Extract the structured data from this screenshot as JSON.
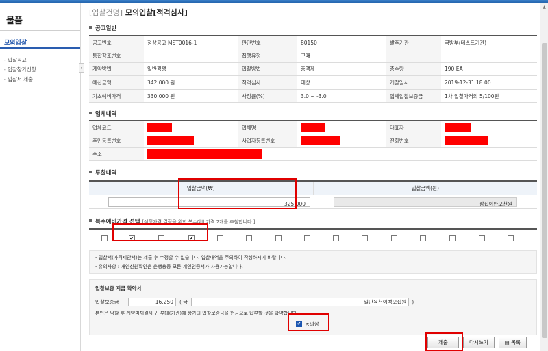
{
  "sidebar": {
    "title": "물품",
    "menu": "모의입찰",
    "items": [
      "- 입찰공고",
      "- 입찰참가신청",
      "- 입찰서 제출"
    ]
  },
  "page": {
    "category": "[입찰건명]",
    "title": "모의입찰[적격심사]"
  },
  "sections": {
    "notice": "공고일반",
    "company": "업체내역",
    "bid": "투찰내역"
  },
  "notice_rows": [
    [
      [
        "공고번호",
        "정상공고 MST0016-1"
      ],
      [
        "판단번호",
        "80150"
      ],
      [
        "발주기관",
        "국방부(테스트기관)"
      ]
    ],
    [
      [
        "통합참조번호",
        ""
      ],
      [
        "집행유형",
        "구매"
      ],
      [
        "",
        ""
      ]
    ],
    [
      [
        "계약방법",
        "일반경쟁"
      ],
      [
        "입찰방법",
        "총액제"
      ],
      [
        "총수량",
        "190 EA"
      ]
    ],
    [
      [
        "예산금액",
        "342,000 원"
      ],
      [
        "적격심사",
        "대상"
      ],
      [
        "개찰일시",
        "2019-12-31 18:00"
      ]
    ],
    [
      [
        "기초예비가격",
        "330,000 원"
      ],
      [
        "사정률(%)",
        "3.0 ~ -3.0"
      ],
      [
        "업체입찰보증금",
        "1차 입찰가격의 5/100원"
      ]
    ]
  ],
  "company": {
    "labels": [
      "업체코드",
      "업체명",
      "대표자",
      "주민등록번호",
      "사업자등록번호",
      "전화번호",
      "주소"
    ]
  },
  "bid": {
    "amount_label": "입찰금액(₩)",
    "amount_value": "325,000",
    "hangul_label": "입찰금액(원)",
    "hangul_value": "삼십이만오천원"
  },
  "multi": {
    "title": "복수예비가격 선택",
    "note": "[예정가격 결정을 위한 복수예비가격 2개를 추첨합니다.]",
    "checked": [
      false,
      true,
      false,
      true,
      false,
      false,
      false,
      false,
      false,
      false,
      false,
      false,
      false,
      false,
      false
    ]
  },
  "notices": [
    "- 입찰서(가격제안서)는 제출 후 수정할 수 없습니다. 입찰내역을 주의하여 작성하시기 바랍니다.",
    "- 유의사항 : 개인신원확인은 은행용등 모든 개인인증서가 사용가능합니다."
  ],
  "guarantee": {
    "title": "입찰보증 지급 확약서",
    "label": "입찰보증금",
    "amount": "16,250",
    "paren_open": "( 금",
    "hangul": "일만육천이백오십원",
    "paren_close": ")",
    "statement": "본인은 낙찰 후 계약미체결시 귀 부대(기관)에 상가의 입찰보증금을 현금으로 납부할 것을 확약합니다.",
    "agree_label": "동의함",
    "agree_checked": "✔"
  },
  "buttons": {
    "submit": "제출",
    "rewrite": "다시쓰기",
    "list": "목록"
  },
  "colors": {
    "highlight": "#e00000",
    "redact": "#ff0000",
    "accent": "#2a5db0"
  }
}
